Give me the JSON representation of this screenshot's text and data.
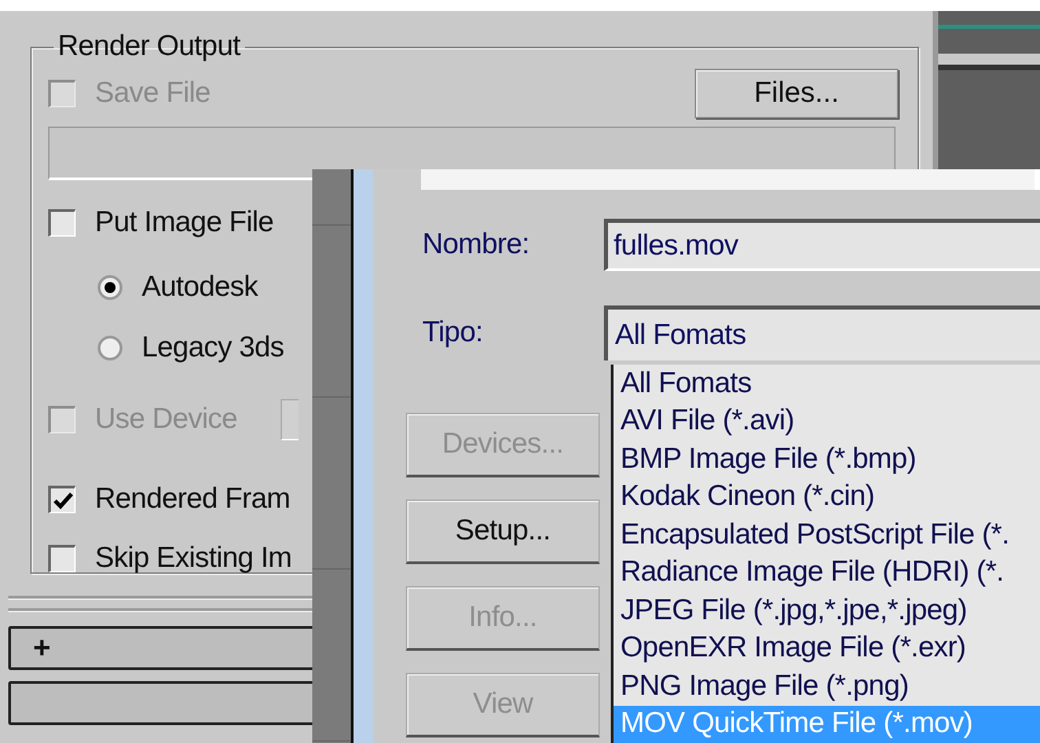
{
  "render_output": {
    "title": "Render Output",
    "save_file": {
      "label": "Save File",
      "checked": false,
      "disabled": true
    },
    "files_button": "Files...",
    "put_image_file": {
      "label": "Put Image File",
      "checked": false,
      "disabled": false
    },
    "radios": [
      {
        "label": "Autodesk",
        "selected": true
      },
      {
        "label": "Legacy 3ds",
        "selected": false
      }
    ],
    "use_device": {
      "label": "Use Device",
      "checked": false,
      "disabled": true
    },
    "options": [
      {
        "label": "Rendered Fram",
        "checked": true,
        "disabled": false
      },
      {
        "label": "Skip Existing Im",
        "checked": false,
        "disabled": false
      }
    ]
  },
  "rollouts": [
    {
      "label": "+"
    }
  ],
  "file_dialog": {
    "name_label": "Nombre:",
    "name_value": "fulles.mov",
    "type_label": "Tipo:",
    "type_value": "All Fomats",
    "type_options": [
      {
        "label": "All Fomats",
        "selected": false
      },
      {
        "label": "AVI File (*.avi)",
        "selected": false
      },
      {
        "label": "BMP Image File (*.bmp)",
        "selected": false
      },
      {
        "label": "Kodak Cineon (*.cin)",
        "selected": false
      },
      {
        "label": "Encapsulated PostScript File (*.",
        "selected": false
      },
      {
        "label": "Radiance Image File (HDRI) (*.",
        "selected": false
      },
      {
        "label": "JPEG File (*.jpg,*.jpe,*.jpeg)",
        "selected": false
      },
      {
        "label": "OpenEXR Image File (*.exr)",
        "selected": false
      },
      {
        "label": "PNG Image File (*.png)",
        "selected": false
      },
      {
        "label": "MOV QuickTime File (*.mov)",
        "selected": true
      }
    ],
    "buttons": [
      {
        "label": "Devices...",
        "disabled": true
      },
      {
        "label": "Setup...",
        "disabled": false
      },
      {
        "label": "Info...",
        "disabled": true
      },
      {
        "label": "View",
        "disabled": true
      }
    ]
  }
}
